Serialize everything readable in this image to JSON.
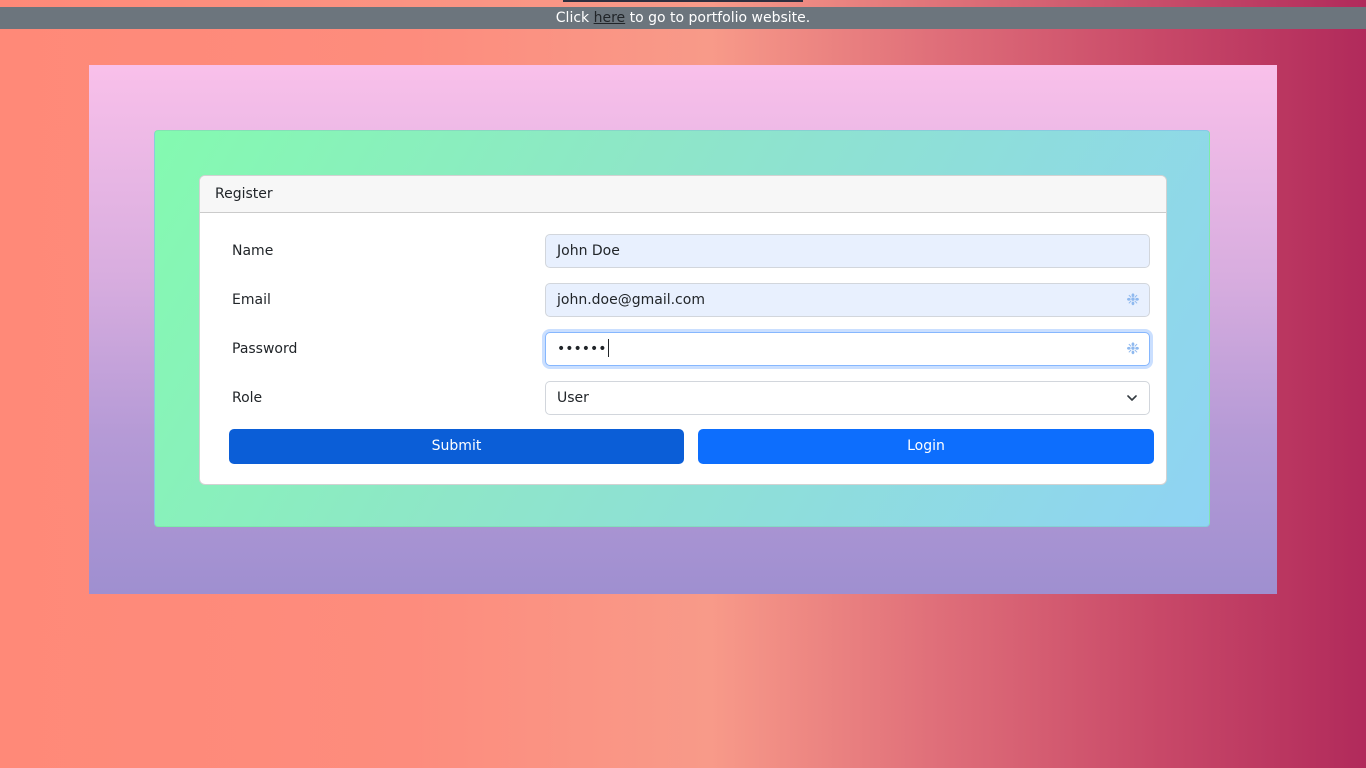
{
  "banner": {
    "prefix": "Click",
    "link_text": "here",
    "suffix": "to go to portfolio website."
  },
  "card": {
    "header": "Register"
  },
  "form": {
    "name": {
      "label": "Name",
      "value": "John Doe"
    },
    "email": {
      "label": "Email",
      "value": "john.doe@gmail.com"
    },
    "password": {
      "label": "Password",
      "value": "••••••"
    },
    "role": {
      "label": "Role",
      "value": "User"
    }
  },
  "buttons": {
    "submit": "Submit",
    "login": "Login"
  },
  "icons": {
    "autofill": "autofill-key-icon",
    "dropdown": "chevron-down-icon"
  },
  "colors": {
    "primary": "#0d6efd",
    "primary_active": "#0b5ed7",
    "banner_bg": "#6c757d"
  }
}
